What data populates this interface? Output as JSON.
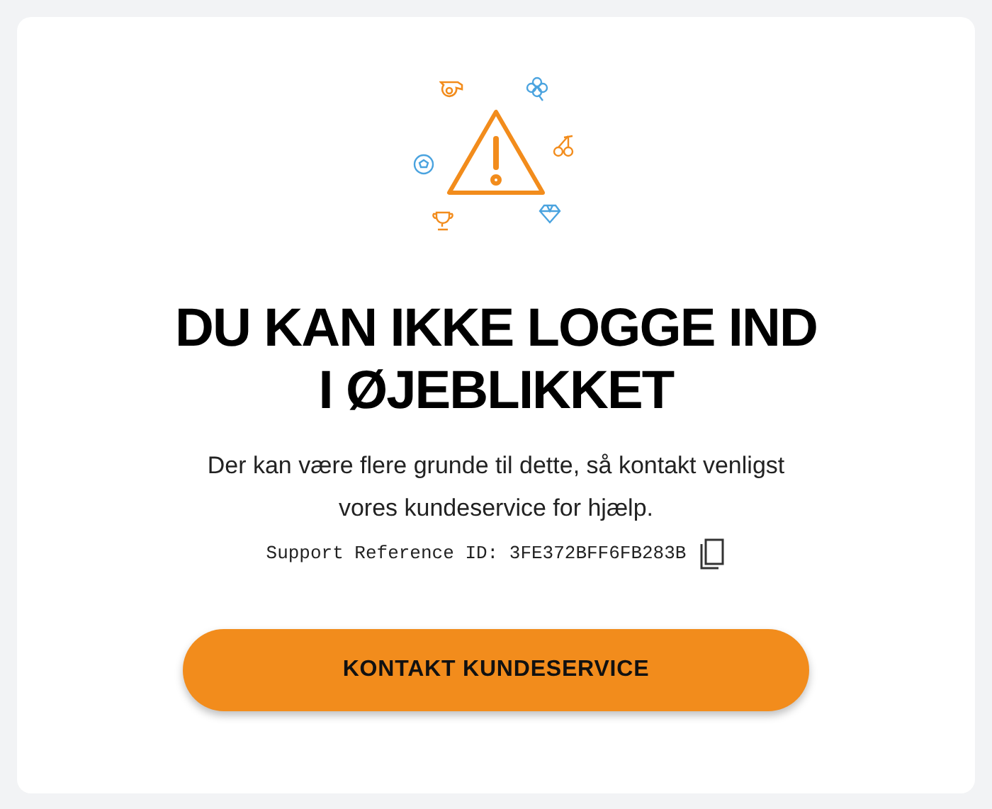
{
  "heading_lines": [
    "DU KAN IKKE LOGGE IND",
    "I ØJEBLIKKET"
  ],
  "message": "Der kan være flere grunde til dette, så kontakt venligst vores kundeservice for hjælp.",
  "support_reference": "Support Reference ID: 3FE372BFF6FB283B",
  "button": {
    "label": "KONTAKT KUNDESERVICE"
  }
}
